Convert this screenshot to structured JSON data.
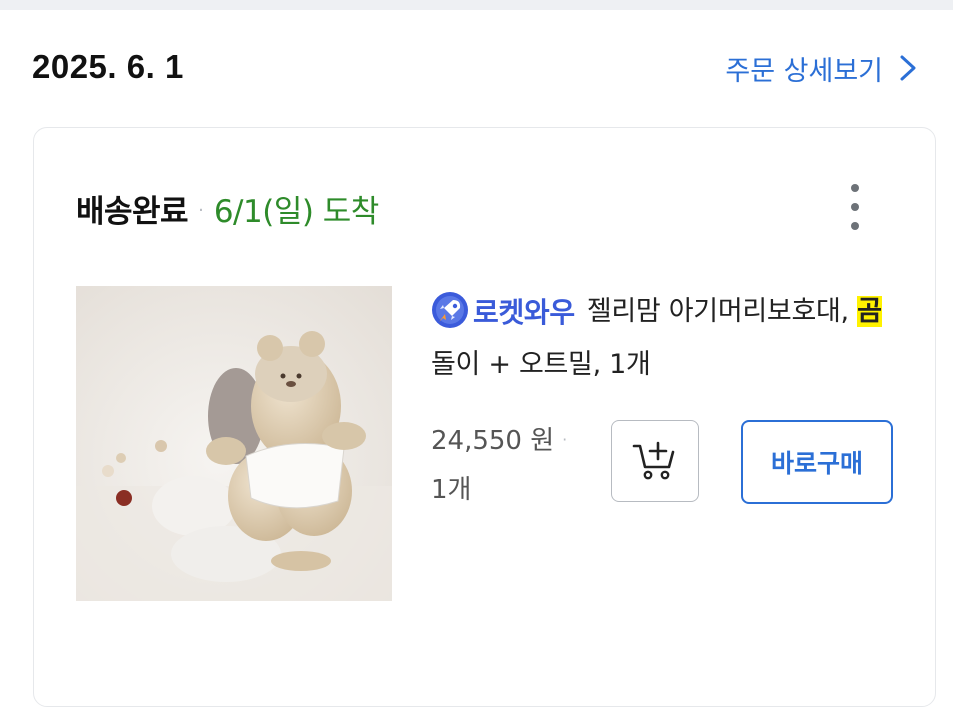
{
  "order": {
    "date": "2025. 6. 1",
    "detail_link_label": "주문 상세보기"
  },
  "card": {
    "status": "배송완료",
    "separator": "·",
    "arrival": "6/1(일) 도착"
  },
  "product": {
    "badge_label": "로켓와우",
    "name_part1": "젤리맘 아기머리보호대, ",
    "name_highlight": "곰",
    "name_part2": "돌이 + 오트밀, 1개",
    "price": "24,550 원",
    "price_separator": "·",
    "quantity": "1개"
  },
  "actions": {
    "buy_now_label": "바로구매"
  },
  "icons": {
    "detail_chevron": "chevron-right-icon",
    "more": "more-vertical-icon",
    "badge": "rocket-icon",
    "cart": "add-to-cart-icon"
  },
  "colors": {
    "accent_blue": "#2b6fd6",
    "arrival_green": "#2e8b2a",
    "badge_blue": "#3a5bd9",
    "highlight": "#fff200"
  }
}
